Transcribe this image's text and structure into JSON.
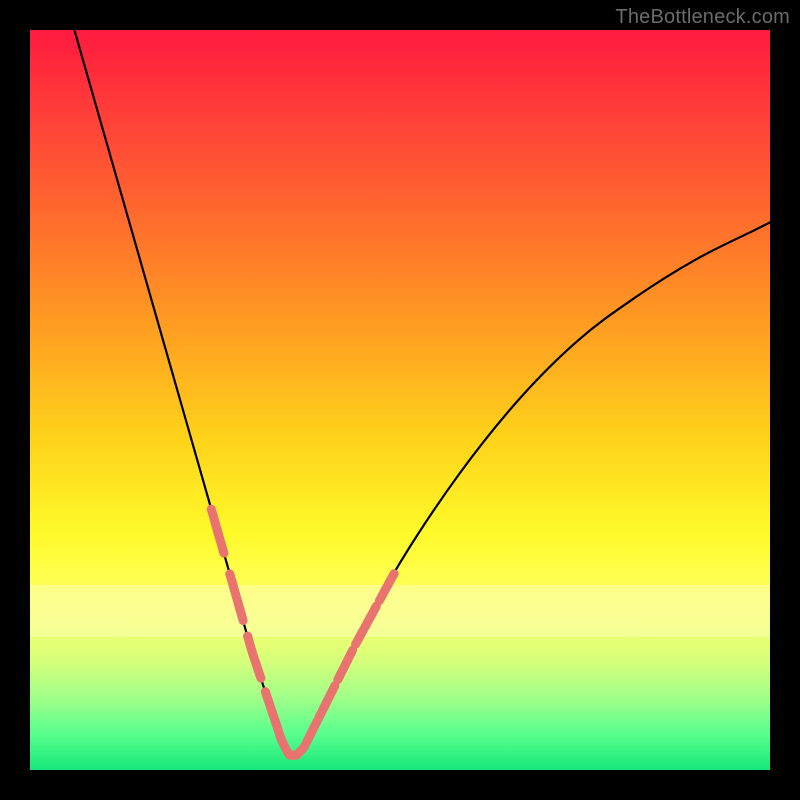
{
  "watermark": "TheBottleneck.com",
  "chart_data": {
    "type": "line",
    "title": "",
    "xlabel": "",
    "ylabel": "",
    "xlim": [
      0,
      100
    ],
    "ylim": [
      0,
      100
    ],
    "grid": false,
    "legend": false,
    "series": [
      {
        "name": "bottleneck-curve",
        "x": [
          6,
          8,
          10,
          12,
          14,
          16,
          18,
          20,
          22,
          24,
          26,
          28,
          30,
          32,
          33,
          34,
          35,
          36,
          37,
          38,
          40,
          44,
          50,
          58,
          66,
          74,
          82,
          90,
          98,
          100
        ],
        "y": [
          100,
          93,
          86,
          79,
          72,
          65,
          58,
          51,
          44,
          37,
          30,
          23,
          16,
          10,
          7,
          4,
          2,
          2,
          3,
          5,
          9,
          17,
          28,
          40,
          50,
          58,
          64,
          69,
          73,
          74
        ]
      }
    ],
    "highlight_band_y": [
      18,
      25
    ],
    "markers": {
      "name": "highlight-segments",
      "color": "#e8736f",
      "stroke_width": 9,
      "segments_x": [
        [
          24.5,
          26.2
        ],
        [
          27.0,
          28.8
        ],
        [
          29.4,
          31.2
        ],
        [
          31.8,
          34.2
        ],
        [
          34.2,
          37.2
        ],
        [
          37.4,
          38.8
        ],
        [
          39.0,
          41.2
        ],
        [
          41.6,
          43.6
        ],
        [
          44.0,
          46.8
        ],
        [
          47.2,
          49.2
        ]
      ]
    }
  }
}
